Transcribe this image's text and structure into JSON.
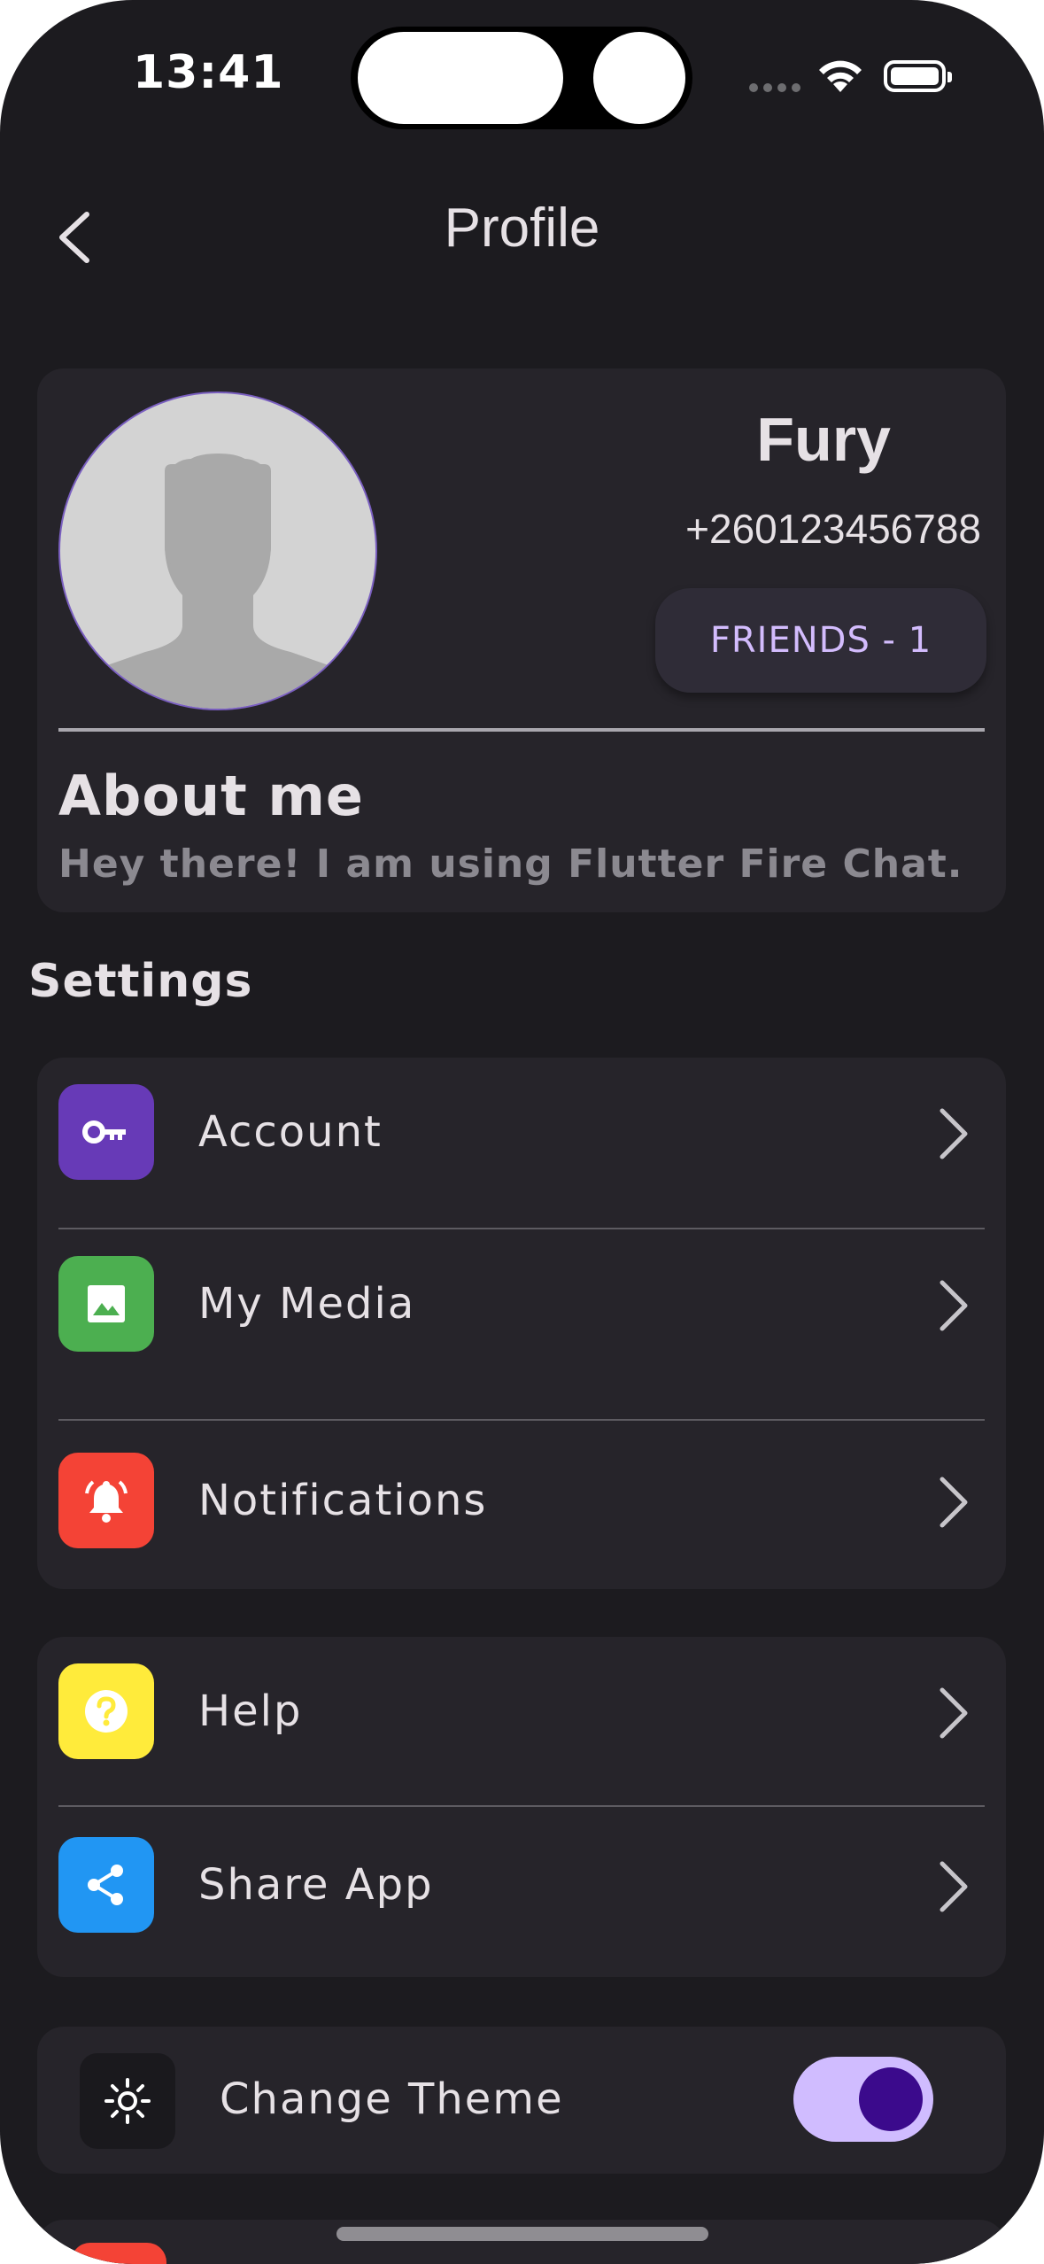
{
  "status_bar": {
    "time": "13:41"
  },
  "header": {
    "title": "Profile"
  },
  "profile": {
    "name": "Fury",
    "phone": "+260123456788",
    "friends_label": "FRIENDS - 1",
    "about_title": "About me",
    "about_text": "Hey there! I am using Flutter Fire Chat."
  },
  "settings": {
    "section_title": "Settings",
    "group1": [
      {
        "label": "Account",
        "icon": "key-icon",
        "color": "#673ab7"
      },
      {
        "label": "My Media",
        "icon": "image-icon",
        "color": "#4caf50"
      },
      {
        "label": "Notifications",
        "icon": "bell-icon",
        "color": "#f44336"
      }
    ],
    "group2": [
      {
        "label": "Help",
        "icon": "help-icon",
        "color": "#ffeb3b"
      },
      {
        "label": "Share App",
        "icon": "share-icon",
        "color": "#2196f3"
      }
    ],
    "theme": {
      "label": "Change Theme",
      "icon": "sun-icon",
      "toggle_on": true,
      "toggle_color": "#d0bcff"
    }
  },
  "colors": {
    "background": "#1c1b1f",
    "card": "#26242a",
    "accent": "#d3bcfd"
  }
}
